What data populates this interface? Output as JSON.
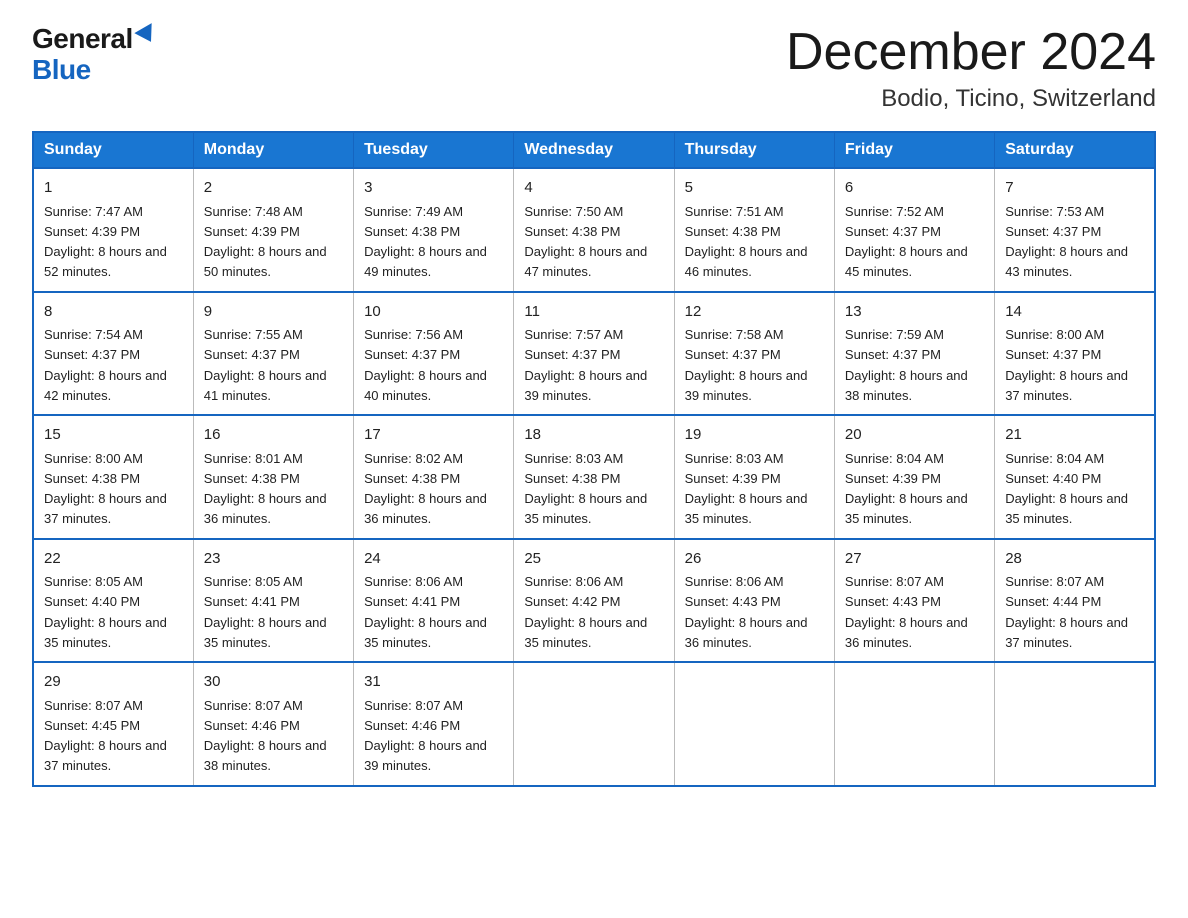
{
  "header": {
    "logo_general": "General",
    "logo_blue": "Blue",
    "month_title": "December 2024",
    "location": "Bodio, Ticino, Switzerland"
  },
  "weekdays": [
    "Sunday",
    "Monday",
    "Tuesday",
    "Wednesday",
    "Thursday",
    "Friday",
    "Saturday"
  ],
  "weeks": [
    [
      {
        "day": "1",
        "sunrise": "7:47 AM",
        "sunset": "4:39 PM",
        "daylight": "8 hours and 52 minutes."
      },
      {
        "day": "2",
        "sunrise": "7:48 AM",
        "sunset": "4:39 PM",
        "daylight": "8 hours and 50 minutes."
      },
      {
        "day": "3",
        "sunrise": "7:49 AM",
        "sunset": "4:38 PM",
        "daylight": "8 hours and 49 minutes."
      },
      {
        "day": "4",
        "sunrise": "7:50 AM",
        "sunset": "4:38 PM",
        "daylight": "8 hours and 47 minutes."
      },
      {
        "day": "5",
        "sunrise": "7:51 AM",
        "sunset": "4:38 PM",
        "daylight": "8 hours and 46 minutes."
      },
      {
        "day": "6",
        "sunrise": "7:52 AM",
        "sunset": "4:37 PM",
        "daylight": "8 hours and 45 minutes."
      },
      {
        "day": "7",
        "sunrise": "7:53 AM",
        "sunset": "4:37 PM",
        "daylight": "8 hours and 43 minutes."
      }
    ],
    [
      {
        "day": "8",
        "sunrise": "7:54 AM",
        "sunset": "4:37 PM",
        "daylight": "8 hours and 42 minutes."
      },
      {
        "day": "9",
        "sunrise": "7:55 AM",
        "sunset": "4:37 PM",
        "daylight": "8 hours and 41 minutes."
      },
      {
        "day": "10",
        "sunrise": "7:56 AM",
        "sunset": "4:37 PM",
        "daylight": "8 hours and 40 minutes."
      },
      {
        "day": "11",
        "sunrise": "7:57 AM",
        "sunset": "4:37 PM",
        "daylight": "8 hours and 39 minutes."
      },
      {
        "day": "12",
        "sunrise": "7:58 AM",
        "sunset": "4:37 PM",
        "daylight": "8 hours and 39 minutes."
      },
      {
        "day": "13",
        "sunrise": "7:59 AM",
        "sunset": "4:37 PM",
        "daylight": "8 hours and 38 minutes."
      },
      {
        "day": "14",
        "sunrise": "8:00 AM",
        "sunset": "4:37 PM",
        "daylight": "8 hours and 37 minutes."
      }
    ],
    [
      {
        "day": "15",
        "sunrise": "8:00 AM",
        "sunset": "4:38 PM",
        "daylight": "8 hours and 37 minutes."
      },
      {
        "day": "16",
        "sunrise": "8:01 AM",
        "sunset": "4:38 PM",
        "daylight": "8 hours and 36 minutes."
      },
      {
        "day": "17",
        "sunrise": "8:02 AM",
        "sunset": "4:38 PM",
        "daylight": "8 hours and 36 minutes."
      },
      {
        "day": "18",
        "sunrise": "8:03 AM",
        "sunset": "4:38 PM",
        "daylight": "8 hours and 35 minutes."
      },
      {
        "day": "19",
        "sunrise": "8:03 AM",
        "sunset": "4:39 PM",
        "daylight": "8 hours and 35 minutes."
      },
      {
        "day": "20",
        "sunrise": "8:04 AM",
        "sunset": "4:39 PM",
        "daylight": "8 hours and 35 minutes."
      },
      {
        "day": "21",
        "sunrise": "8:04 AM",
        "sunset": "4:40 PM",
        "daylight": "8 hours and 35 minutes."
      }
    ],
    [
      {
        "day": "22",
        "sunrise": "8:05 AM",
        "sunset": "4:40 PM",
        "daylight": "8 hours and 35 minutes."
      },
      {
        "day": "23",
        "sunrise": "8:05 AM",
        "sunset": "4:41 PM",
        "daylight": "8 hours and 35 minutes."
      },
      {
        "day": "24",
        "sunrise": "8:06 AM",
        "sunset": "4:41 PM",
        "daylight": "8 hours and 35 minutes."
      },
      {
        "day": "25",
        "sunrise": "8:06 AM",
        "sunset": "4:42 PM",
        "daylight": "8 hours and 35 minutes."
      },
      {
        "day": "26",
        "sunrise": "8:06 AM",
        "sunset": "4:43 PM",
        "daylight": "8 hours and 36 minutes."
      },
      {
        "day": "27",
        "sunrise": "8:07 AM",
        "sunset": "4:43 PM",
        "daylight": "8 hours and 36 minutes."
      },
      {
        "day": "28",
        "sunrise": "8:07 AM",
        "sunset": "4:44 PM",
        "daylight": "8 hours and 37 minutes."
      }
    ],
    [
      {
        "day": "29",
        "sunrise": "8:07 AM",
        "sunset": "4:45 PM",
        "daylight": "8 hours and 37 minutes."
      },
      {
        "day": "30",
        "sunrise": "8:07 AM",
        "sunset": "4:46 PM",
        "daylight": "8 hours and 38 minutes."
      },
      {
        "day": "31",
        "sunrise": "8:07 AM",
        "sunset": "4:46 PM",
        "daylight": "8 hours and 39 minutes."
      },
      null,
      null,
      null,
      null
    ]
  ]
}
